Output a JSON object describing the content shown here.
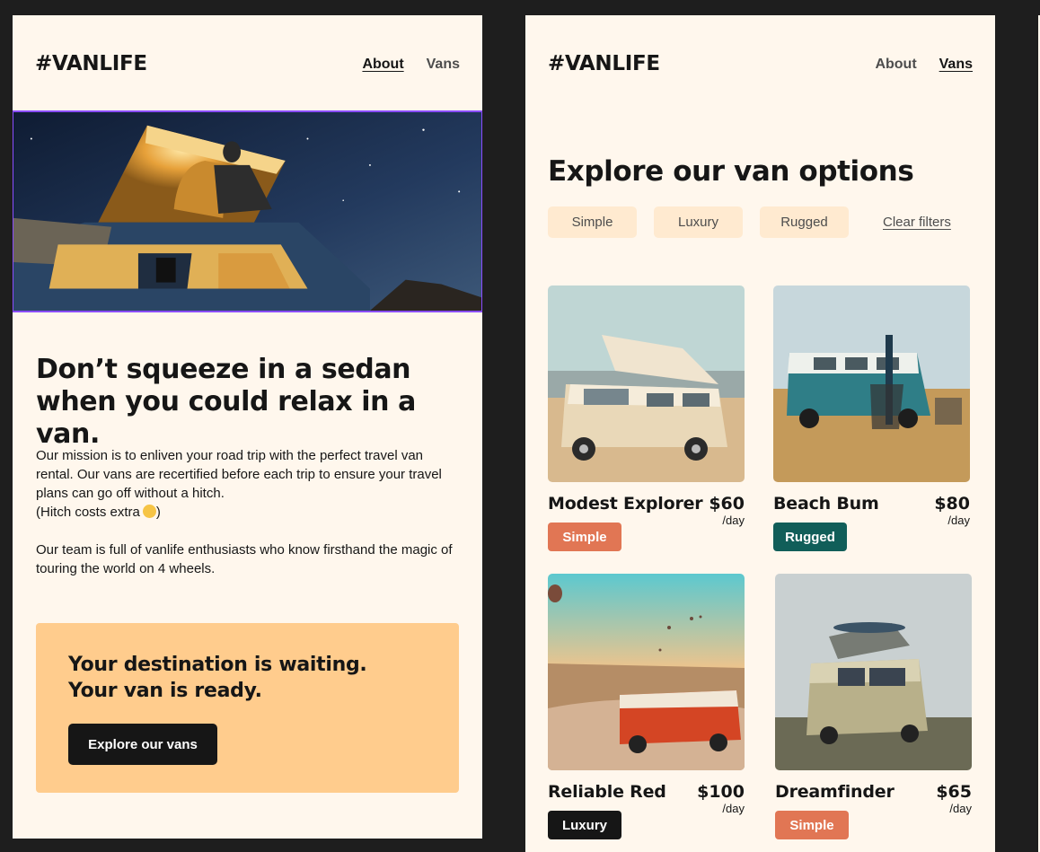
{
  "about_page": {
    "logo": "#VANLIFE",
    "nav": {
      "about": "About",
      "vans": "Vans",
      "active": "about"
    },
    "headline": "Don’t squeeze in a sedan when you could relax in a van.",
    "mission_paragraphs": [
      "Our mission is to enliven your road trip with the perfect travel van rental. Our vans are recertified before each trip to ensure your travel plans can go off without a hitch.",
      "(Hitch costs extra",
      "Our team is full of vanlife enthusiasts who know firsthand the magic of touring the world on 4 wheels."
    ],
    "paren_close": ")",
    "cta": {
      "title_line1": "Your destination is waiting.",
      "title_line2": "Your van is ready.",
      "button": "Explore our vans"
    }
  },
  "vans_page": {
    "logo": "#VANLIFE",
    "nav": {
      "about": "About",
      "vans": "Vans",
      "active": "vans"
    },
    "title": "Explore our van options",
    "filters": [
      "Simple",
      "Luxury",
      "Rugged"
    ],
    "clear_filters": "Clear filters",
    "per_day": "/day",
    "vans": [
      {
        "name": "Modest Explorer",
        "price": "$60",
        "type": "Simple"
      },
      {
        "name": "Beach Bum",
        "price": "$80",
        "type": "Rugged"
      },
      {
        "name": "Reliable Red",
        "price": "$100",
        "type": "Luxury"
      },
      {
        "name": "Dreamfinder",
        "price": "$65",
        "type": "Simple"
      }
    ]
  },
  "colors": {
    "page_bg": "#fff7ed",
    "canvas_bg": "#1e1e1e",
    "cta_bg": "#ffcc8d",
    "filter_bg": "#ffead0",
    "badge_simple": "#e17654",
    "badge_rugged": "#115e59",
    "badge_luxury": "#161616",
    "selection_outline": "#8a4dff"
  }
}
